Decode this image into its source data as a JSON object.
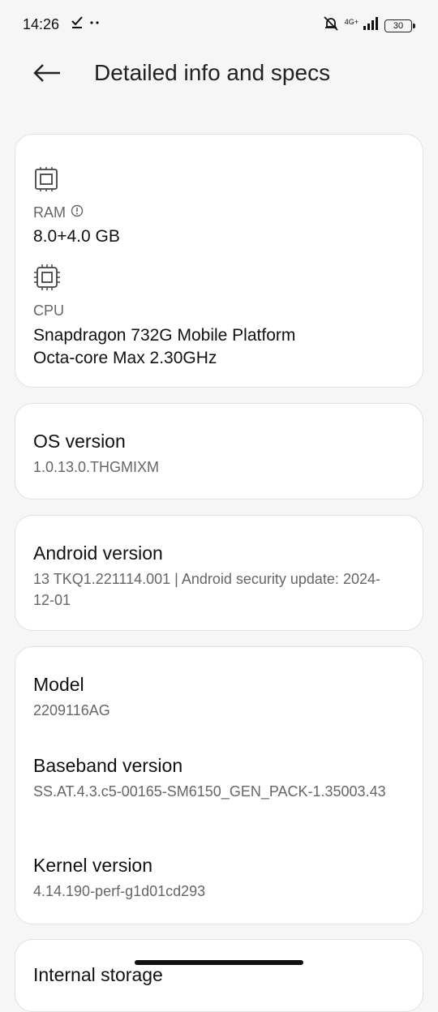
{
  "status_bar": {
    "time": "14:26",
    "network": "4G+",
    "battery": "30",
    "icons": [
      "check-download-icon",
      "more-dots-icon",
      "silent-bell-icon",
      "signal-icon",
      "battery-icon"
    ]
  },
  "header": {
    "title": "Detailed info and specs",
    "back_icon": "arrow-left-icon"
  },
  "specs_card": {
    "ram": {
      "label": "RAM",
      "value": "8.0+4.0 GB",
      "icon": "ram-chip-icon"
    },
    "cpu": {
      "label": "CPU",
      "line1": "Snapdragon 732G Mobile Platform",
      "line2": "Octa-core Max 2.30GHz",
      "icon": "cpu-chip-icon"
    }
  },
  "os_card": {
    "title": "OS version",
    "value": "1.0.13.0.THGMIXM"
  },
  "android_card": {
    "title": "Android version",
    "value": "13 TKQ1.221114.001 | Android security update: 2024-12-01"
  },
  "device_card": {
    "model": {
      "title": "Model",
      "value": "2209116AG"
    },
    "baseband": {
      "title": "Baseband version",
      "value": "SS.AT.4.3.c5-00165-SM6150_GEN_PACK-1.35003.43"
    },
    "kernel": {
      "title": "Kernel version",
      "value": "4.14.190-perf-g1d01cd293"
    }
  },
  "partial_card": {
    "title": "Internal storage"
  }
}
